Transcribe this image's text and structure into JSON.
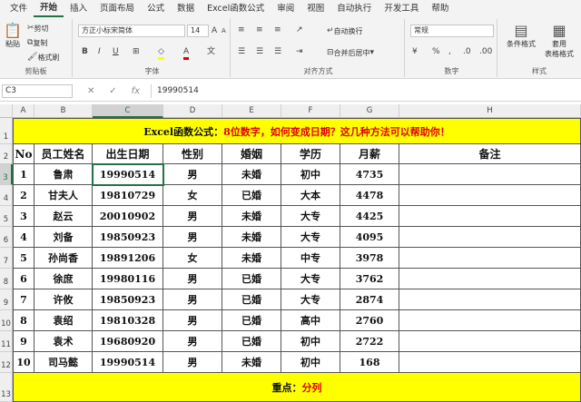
{
  "menu": [
    "文件",
    "开始",
    "插入",
    "页面布局",
    "公式",
    "数据",
    "Excel函数公式",
    "审阅",
    "视图",
    "自动执行",
    "开发工具",
    "帮助"
  ],
  "ribbon": {
    "clipboard": {
      "label": "剪贴板",
      "paste": "粘贴",
      "cut": "剪切",
      "copy": "复制",
      "painter": "格式刷"
    },
    "font": {
      "label": "字体",
      "name": "方正小标宋简体",
      "size": "14"
    },
    "align": {
      "label": "对齐方式",
      "wrap": "自动换行",
      "merge": "合并后居中"
    },
    "number": {
      "label": "数字",
      "format": "常规"
    },
    "styles": {
      "label": "样式",
      "cond": "条件格式",
      "table": "套用",
      "table2": "表格格式"
    }
  },
  "formula_bar": {
    "name_box": "C3",
    "value": "19990514"
  },
  "columns": [
    "A",
    "B",
    "C",
    "D",
    "E",
    "F",
    "G",
    "H"
  ],
  "rows": [
    "1",
    "2",
    "3",
    "4",
    "5",
    "6",
    "7",
    "8",
    "9",
    "10",
    "11",
    "12",
    "13"
  ],
  "title": {
    "prefix": "Excel函数公式：",
    "text": "8位数字，如何变成日期？这几种方法可以帮助你！"
  },
  "headers": [
    "No",
    "员工姓名",
    "出生日期",
    "性别",
    "婚姻",
    "学历",
    "月薪",
    "备注"
  ],
  "records": [
    [
      "1",
      "鲁肃",
      "19990514",
      "男",
      "未婚",
      "初中",
      "4735",
      ""
    ],
    [
      "2",
      "甘夫人",
      "19810729",
      "女",
      "已婚",
      "大本",
      "4478",
      ""
    ],
    [
      "3",
      "赵云",
      "20010902",
      "男",
      "未婚",
      "大专",
      "4425",
      ""
    ],
    [
      "4",
      "刘备",
      "19850923",
      "男",
      "未婚",
      "大专",
      "4095",
      ""
    ],
    [
      "5",
      "孙尚香",
      "19891206",
      "女",
      "未婚",
      "中专",
      "3978",
      ""
    ],
    [
      "6",
      "徐庶",
      "19980116",
      "男",
      "已婚",
      "大专",
      "3762",
      ""
    ],
    [
      "7",
      "许攸",
      "19850923",
      "男",
      "已婚",
      "大专",
      "2874",
      ""
    ],
    [
      "8",
      "袁绍",
      "19810328",
      "男",
      "已婚",
      "高中",
      "2760",
      ""
    ],
    [
      "9",
      "袁术",
      "19680920",
      "男",
      "已婚",
      "初中",
      "2722",
      ""
    ],
    [
      "10",
      "司马懿",
      "19990514",
      "男",
      "未婚",
      "初中",
      "168",
      ""
    ]
  ],
  "footer": {
    "label": "重点：",
    "value": "分列"
  },
  "colors": {
    "accent": "#217346",
    "highlight": "#ffff00",
    "emphasis": "#e00000"
  }
}
